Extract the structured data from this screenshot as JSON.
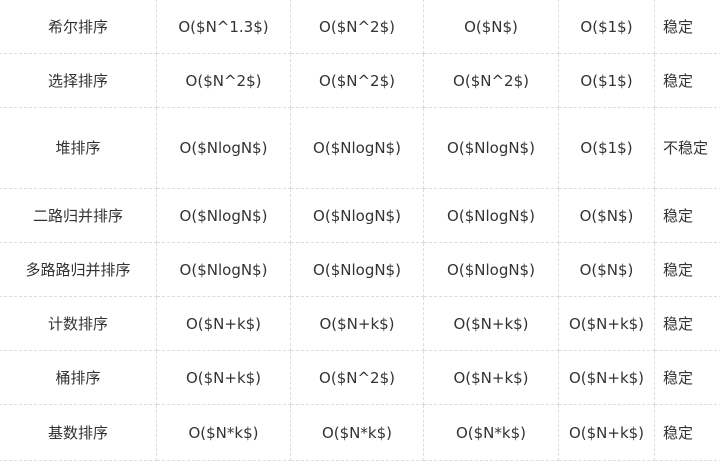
{
  "table": {
    "rows": [
      {
        "name": "希尔排序",
        "c1": "O($N^1.3$)",
        "c2": "O($N^2$)",
        "c3": "O($N$)",
        "c4": "O($1$)",
        "stability": "稳定",
        "tall": false
      },
      {
        "name": "选择排序",
        "c1": "O($N^2$)",
        "c2": "O($N^2$)",
        "c3": "O($N^2$)",
        "c4": "O($1$)",
        "stability": "稳定",
        "tall": false
      },
      {
        "name": "堆排序",
        "c1": "O($NlogN$)",
        "c2": "O($NlogN$)",
        "c3": "O($NlogN$)",
        "c4": "O($1$)",
        "stability": "不稳定",
        "tall": true
      },
      {
        "name": "二路归并排序",
        "c1": "O($NlogN$)",
        "c2": "O($NlogN$)",
        "c3": "O($NlogN$)",
        "c4": "O($N$)",
        "stability": "稳定",
        "tall": false
      },
      {
        "name": "多路路归并排序",
        "c1": "O($NlogN$)",
        "c2": "O($NlogN$)",
        "c3": "O($NlogN$)",
        "c4": "O($N$)",
        "stability": "稳定",
        "tall": false
      },
      {
        "name": "计数排序",
        "c1": "O($N+k$)",
        "c2": "O($N+k$)",
        "c3": "O($N+k$)",
        "c4": "O($N+k$)",
        "stability": "稳定",
        "tall": false
      },
      {
        "name": "桶排序",
        "c1": "O($N+k$)",
        "c2": "O($N^2$)",
        "c3": "O($N+k$)",
        "c4": "O($N+k$)",
        "stability": "稳定",
        "tall": false
      },
      {
        "name": "基数排序",
        "c1": "O($N*k$)",
        "c2": "O($N*k$)",
        "c3": "O($N*k$)",
        "c4": "O($N+k$)",
        "stability": "稳定",
        "tall": false
      }
    ]
  }
}
